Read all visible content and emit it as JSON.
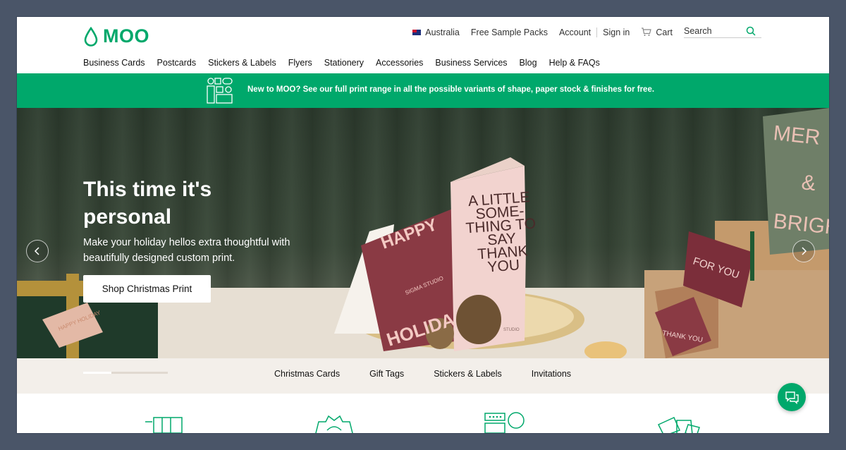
{
  "header": {
    "logo_text": "MOO",
    "utility": {
      "country": "Australia",
      "free_samples": "Free Sample Packs",
      "account": "Account",
      "sign_in": "Sign in",
      "cart": "Cart",
      "search_placeholder": "Search"
    },
    "nav": [
      "Business Cards",
      "Postcards",
      "Stickers & Labels",
      "Flyers",
      "Stationery",
      "Accessories",
      "Business Services",
      "Blog",
      "Help & FAQs"
    ]
  },
  "promo": {
    "text": "New to MOO? See our full print range in all the possible variants of shape, paper stock & finishes for free."
  },
  "hero": {
    "title": "This time it's personal",
    "subtitle": "Make your holiday hellos extra thoughtful with beautifully designed custom print.",
    "cta": "Shop Christmas Print",
    "card_texts": {
      "happy": "HAPPY",
      "holiday": "HOLIDA",
      "sigma": "SIGMA STUDIO",
      "main_card": "A LITTLE SOME- THING TO SAY THANK YOU",
      "studio": "STUDIO",
      "for_you": "FOR YOU",
      "merry": "MER",
      "and": "&",
      "bright": "BRIGH",
      "thank_you": "THANK YOU",
      "gift_tag": "HAPPY HOLIDAY"
    },
    "slide_progress": 0.33
  },
  "categories": [
    "Christmas Cards",
    "Gift Tags",
    "Stickers & Labels",
    "Invitations"
  ],
  "colors": {
    "brand_green": "#00a86b",
    "hero_dark": "#2f3e30",
    "category_bg": "#f3efea"
  },
  "icons": {
    "logo": "drop-icon",
    "cart": "cart-icon",
    "search": "search-icon",
    "chat": "chat-icon",
    "prev": "chevron-left-icon",
    "next": "chevron-right-icon"
  }
}
